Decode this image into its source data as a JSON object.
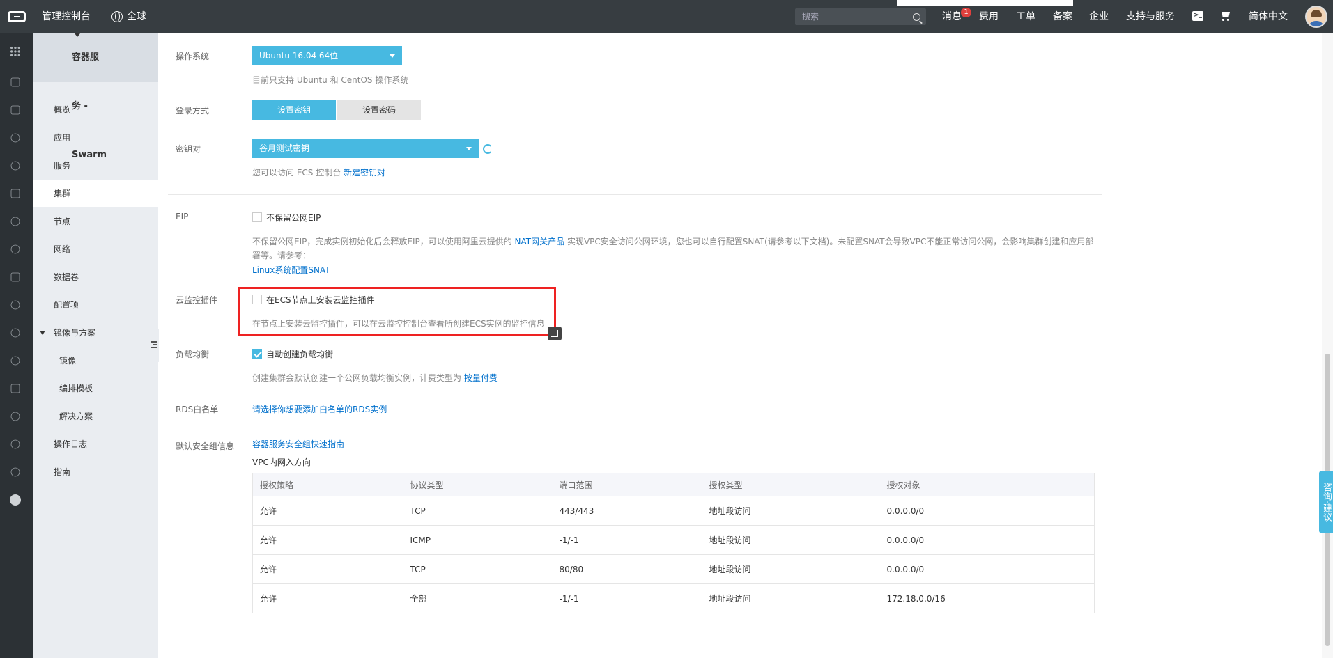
{
  "topbar": {
    "console": "管理控制台",
    "region": "全球",
    "search_placeholder": "搜索",
    "nav": {
      "messages": "消息",
      "messages_badge": "1",
      "fees": "费用",
      "tickets": "工单",
      "filing": "备案",
      "enterprise": "企业",
      "support": "支持与服务",
      "language": "简体中文"
    }
  },
  "sidebar": {
    "title": "容器服务 - Swarm",
    "items": [
      {
        "label": "概览"
      },
      {
        "label": "应用"
      },
      {
        "label": "服务"
      },
      {
        "label": "集群"
      },
      {
        "label": "节点"
      },
      {
        "label": "网络"
      },
      {
        "label": "数据卷"
      },
      {
        "label": "配置项"
      },
      {
        "label": "镜像与方案"
      },
      {
        "label": "镜像"
      },
      {
        "label": "编排模板"
      },
      {
        "label": "解决方案"
      },
      {
        "label": "操作日志"
      },
      {
        "label": "指南"
      }
    ]
  },
  "form": {
    "os": {
      "label": "操作系统",
      "value": "Ubuntu 16.04 64位",
      "help": "目前只支持 Ubuntu 和 CentOS 操作系统"
    },
    "login": {
      "label": "登录方式",
      "option_key": "设置密钥",
      "option_password": "设置密码"
    },
    "keypair": {
      "label": "密钥对",
      "value": "谷月测试密钥",
      "help_prefix": "您可以访问 ECS 控制台",
      "help_link": "新建密钥对"
    },
    "eip": {
      "label": "EIP",
      "checkbox": "不保留公网EIP",
      "help_prefix": "不保留公网EIP，完成实例初始化后会释放EIP，可以使用阿里云提供的",
      "help_link": "NAT网关产品",
      "help_suffix": "实现VPC安全访问公网环境，您也可以自行配置SNAT(请参考以下文档)。未配置SNAT会导致VPC不能正常访问公网，会影响集群创建和应用部署等。请参考：",
      "doc_link": "Linux系统配置SNAT"
    },
    "monitor": {
      "label": "云监控插件",
      "checkbox": "在ECS节点上安装云监控插件",
      "help": "在节点上安装云监控插件，可以在云监控控制台查看所创建ECS实例的监控信息"
    },
    "slb": {
      "label": "负载均衡",
      "checkbox": "自动创建负载均衡",
      "help_prefix": "创建集群会默认创建一个公网负载均衡实例，计费类型为",
      "help_link": "按量付费"
    },
    "rds": {
      "label": "RDS白名单",
      "link": "请选择你想要添加白名单的RDS实例"
    },
    "security": {
      "label": "默认安全组信息",
      "link": "容器服务安全组快速指南",
      "direction": "VPC内网入方向"
    }
  },
  "table": {
    "headers": [
      "授权策略",
      "协议类型",
      "端口范围",
      "授权类型",
      "授权对象"
    ],
    "rows": [
      [
        "允许",
        "TCP",
        "443/443",
        "地址段访问",
        "0.0.0.0/0"
      ],
      [
        "允许",
        "ICMP",
        "-1/-1",
        "地址段访问",
        "0.0.0.0/0"
      ],
      [
        "允许",
        "TCP",
        "80/80",
        "地址段访问",
        "0.0.0.0/0"
      ],
      [
        "允许",
        "全部",
        "-1/-1",
        "地址段访问",
        "172.18.0.0/16"
      ]
    ]
  },
  "feedback_tab": "咨询·建议",
  "colors": {
    "topbar": "#373d41",
    "accent": "#47b9e1",
    "link": "#0070cc",
    "highlight_box": "#ee2222"
  }
}
